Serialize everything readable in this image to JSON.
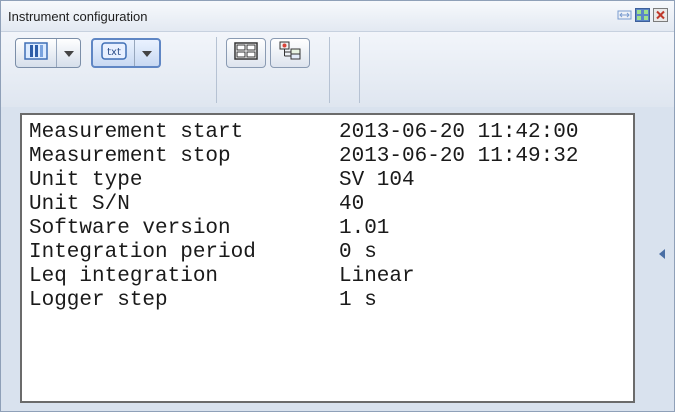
{
  "window": {
    "title": "Instrument configuration"
  },
  "title_controls": [
    {
      "icon": "auto-hide-icon"
    },
    {
      "icon": "float-icon"
    },
    {
      "icon": "close-icon"
    }
  ],
  "toolbar": {
    "buttons": [
      {
        "icon": "columns-view-icon",
        "has_dropdown": true
      },
      {
        "icon": "txt-format-icon",
        "label": "txt",
        "has_dropdown": true
      },
      {
        "icon": "split-panes-icon"
      },
      {
        "icon": "tree-view-icon"
      }
    ]
  },
  "config": {
    "rows": [
      {
        "key": "Measurement start",
        "value": "2013-06-20 11:42:00"
      },
      {
        "key": "Measurement stop",
        "value": "2013-06-20 11:49:32"
      },
      {
        "key": "Unit type",
        "value": "SV 104"
      },
      {
        "key": "Unit S/N",
        "value": "40"
      },
      {
        "key": "Software version",
        "value": "1.01"
      },
      {
        "key": "Integration period",
        "value": "0 s"
      },
      {
        "key": "Leq integration",
        "value": "Linear"
      },
      {
        "key": "Logger step",
        "value": "1 s"
      }
    ]
  },
  "colors": {
    "window_bg": "#d9e2ee",
    "accent": "#5f86c4",
    "close_red": "#c0392b"
  }
}
